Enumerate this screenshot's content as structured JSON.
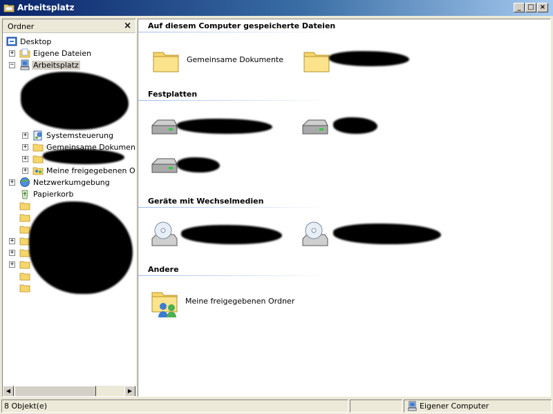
{
  "window": {
    "title": "Arbeitsplatz"
  },
  "caption_buttons": {
    "minimize": "_",
    "maximize": "□",
    "close": "×"
  },
  "folders_pane": {
    "title": "Ordner",
    "close_label": "×",
    "tree": [
      {
        "label": "Desktop",
        "icon": "desktop-icon"
      },
      {
        "label": "Eigene Dateien",
        "icon": "my-documents-icon",
        "expander": "+"
      },
      {
        "label": "Arbeitsplatz",
        "icon": "my-computer-icon",
        "expander": "−",
        "selected": true
      },
      {
        "label": "Systemsteuerung",
        "icon": "control-panel-icon",
        "expander": "+"
      },
      {
        "label": "Gemeinsame Dokumente",
        "icon": "folder-icon",
        "expander": "+"
      },
      {
        "label": "",
        "icon": "folder-icon",
        "expander": "+"
      },
      {
        "label": "Meine freigegebenen Ordner",
        "icon": "shared-folder-icon",
        "expander": "+"
      },
      {
        "label": "Netzwerkumgebung",
        "icon": "network-icon",
        "expander": "+"
      },
      {
        "label": "Papierkorb",
        "icon": "recycle-bin-icon"
      }
    ]
  },
  "content": {
    "groups": [
      {
        "title": "Auf diesem Computer gespeicherte Dateien",
        "items": [
          {
            "label": "Gemeinsame Dokumente",
            "icon": "folder-icon"
          },
          {
            "label": "",
            "icon": "folder-icon"
          }
        ]
      },
      {
        "title": "Festplatten",
        "items": [
          {
            "label": "",
            "icon": "hard-drive-icon"
          },
          {
            "label": "",
            "icon": "hard-drive-icon"
          },
          {
            "label": "",
            "icon": "hard-drive-icon"
          }
        ]
      },
      {
        "title": "Geräte mit Wechselmedien",
        "items": [
          {
            "label": "",
            "icon": "cd-drive-icon"
          },
          {
            "label": "",
            "icon": "cd-drive-icon"
          }
        ]
      },
      {
        "title": "Andere",
        "items": [
          {
            "label": "Meine freigegebenen Ordner",
            "icon": "shared-folder-icon"
          }
        ]
      }
    ]
  },
  "statusbar": {
    "object_count": "8 Objekt(e)",
    "zone": "Eigener Computer"
  },
  "colors": {
    "titlebar_start": "#0A246A",
    "titlebar_end": "#A6CAF0",
    "face": "#ECE9D8",
    "group_line": "#9DB9EB"
  }
}
